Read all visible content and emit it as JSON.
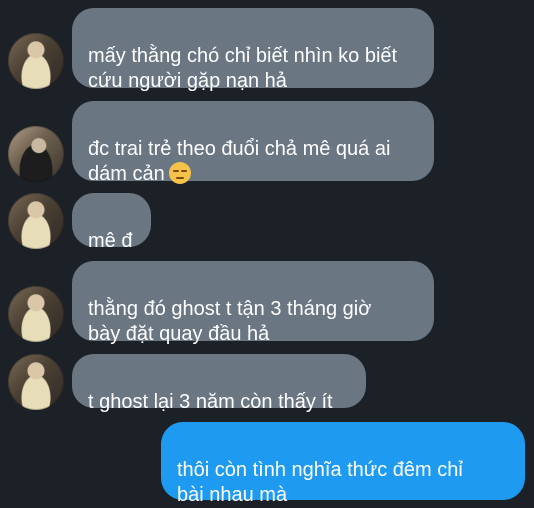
{
  "messages": [
    {
      "direction": "in",
      "text": "mấy thằng chó chỉ biết nhìn ko biết\ncứu người gặp nạn hả",
      "avatar": "avatar-icon"
    },
    {
      "direction": "in",
      "text": "đc trai trẻ theo đuổi chả mê quá ai\ndám cản",
      "emoji": "pensive-face-icon",
      "avatar": "avatar-icon"
    },
    {
      "direction": "in",
      "text": "mê đ",
      "avatar": "avatar-icon"
    },
    {
      "direction": "in",
      "text": "thằng đó ghost t tận 3 tháng giờ\nbày đặt quay đầu hả",
      "avatar": "avatar-icon"
    },
    {
      "direction": "in",
      "text": "t ghost lại 3 năm còn thấy ít",
      "avatar": "avatar-icon"
    },
    {
      "direction": "out",
      "text": "thôi còn tình nghĩa thức đêm chỉ\nbài nhau mà"
    }
  ],
  "colors": {
    "background": "#1c2128",
    "incoming_bubble": "#6b7683",
    "outgoing_bubble": "#1e9bf0",
    "text": "#ffffff"
  }
}
